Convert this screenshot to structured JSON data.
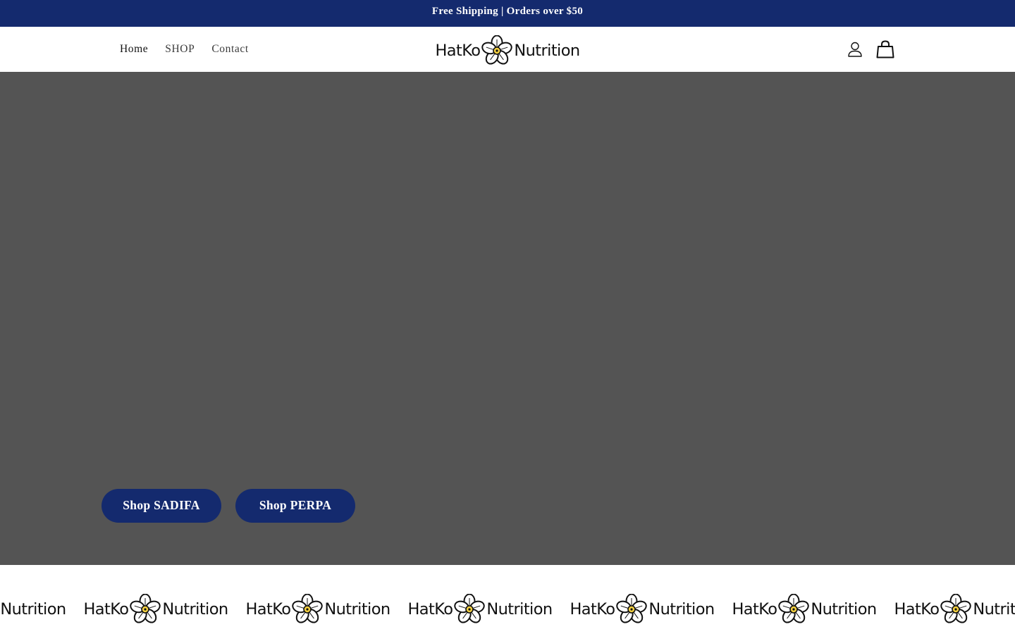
{
  "announcement": {
    "text": "Free Shipping | Orders over $50"
  },
  "header": {
    "nav": [
      {
        "label": "Home"
      },
      {
        "label": "SHOP"
      },
      {
        "label": "Contact"
      }
    ],
    "logo": {
      "left_text": "HatKo",
      "right_text": "Nutrition",
      "icon": "flower-logo-icon"
    },
    "icons": [
      "account-icon",
      "cart-icon"
    ]
  },
  "hero": {
    "buttons": [
      {
        "label": "Shop SADIFA"
      },
      {
        "label": "Shop PERPA"
      }
    ]
  },
  "marquee": {
    "brand_left": "HatKo",
    "brand_right": "Nutrition",
    "repeat_count": 7
  },
  "colors": {
    "brand_navy": "#142a6e",
    "hero_bg": "#545454",
    "text": "#121212"
  }
}
